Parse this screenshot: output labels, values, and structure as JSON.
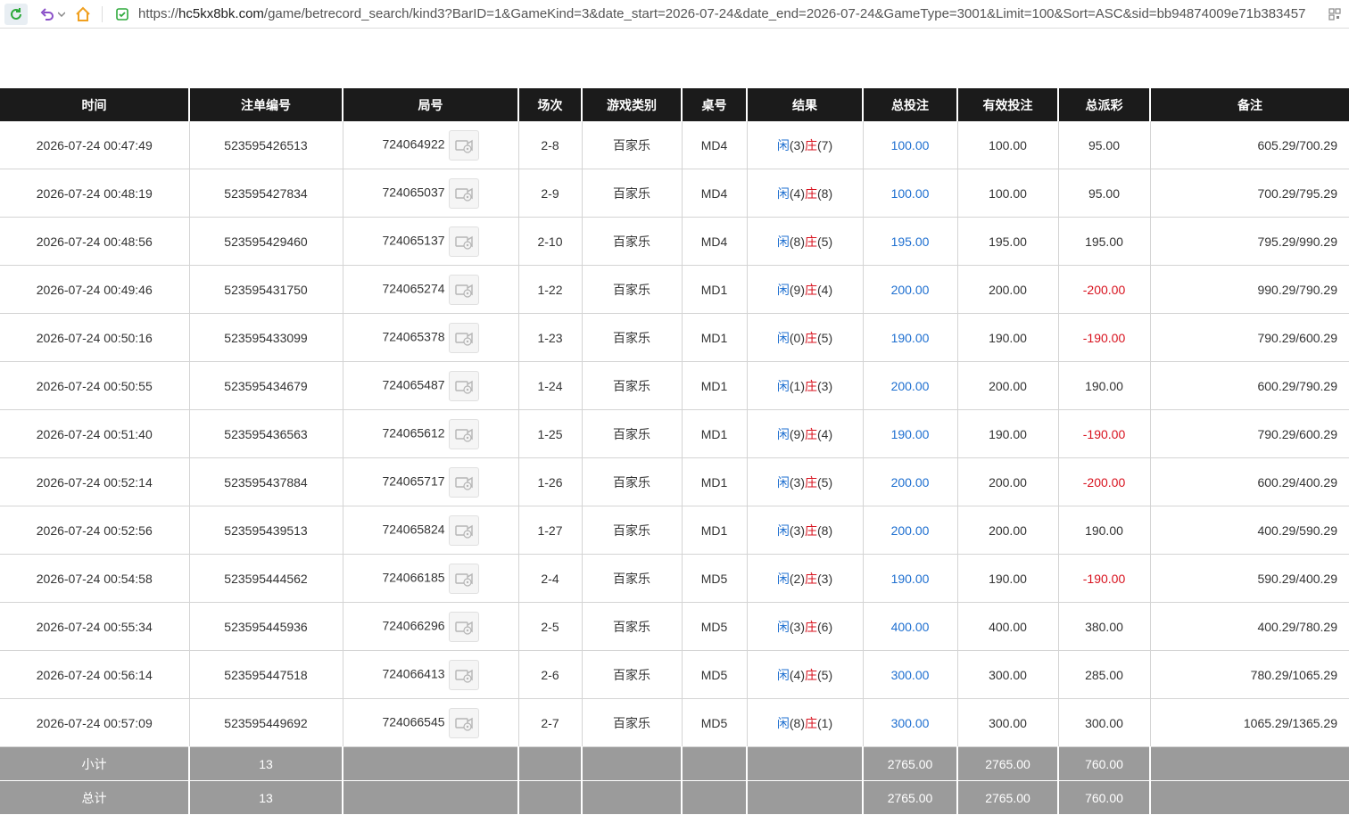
{
  "browser": {
    "url_prefix": "https://",
    "url_host": "hc5kx8bk.com",
    "url_path": "/game/betrecord_search/kind3?BarID=1&GameKind=3&date_start=2026-07-24&date_end=2026-07-24&GameType=3001&Limit=100&Sort=ASC&sid=bb94874009e71b383457",
    "icons": [
      "refresh-icon",
      "undo-icon",
      "chevron-down-icon",
      "home-icon",
      "shield-check-icon",
      "qr-code-icon"
    ]
  },
  "table": {
    "headers": [
      "时间",
      "注单编号",
      "局号",
      "场次",
      "游戏类别",
      "桌号",
      "结果",
      "总投注",
      "有效投注",
      "总派彩",
      "备注"
    ],
    "result_labels": {
      "player": "闲",
      "banker": "庄"
    },
    "rows": [
      {
        "time": "2026-07-24 00:47:49",
        "bet_id": "523595426513",
        "round": "724064922",
        "session": "2-8",
        "game": "百家乐",
        "table": "MD4",
        "p": "(3)",
        "b": "(7)",
        "total": "100.00",
        "valid": "100.00",
        "payout": "95.00",
        "note": "605.29/700.29"
      },
      {
        "time": "2026-07-24 00:48:19",
        "bet_id": "523595427834",
        "round": "724065037",
        "session": "2-9",
        "game": "百家乐",
        "table": "MD4",
        "p": "(4)",
        "b": "(8)",
        "total": "100.00",
        "valid": "100.00",
        "payout": "95.00",
        "note": "700.29/795.29"
      },
      {
        "time": "2026-07-24 00:48:56",
        "bet_id": "523595429460",
        "round": "724065137",
        "session": "2-10",
        "game": "百家乐",
        "table": "MD4",
        "p": "(8)",
        "b": "(5)",
        "total": "195.00",
        "valid": "195.00",
        "payout": "195.00",
        "note": "795.29/990.29"
      },
      {
        "time": "2026-07-24 00:49:46",
        "bet_id": "523595431750",
        "round": "724065274",
        "session": "1-22",
        "game": "百家乐",
        "table": "MD1",
        "p": "(9)",
        "b": "(4)",
        "total": "200.00",
        "valid": "200.00",
        "payout": "-200.00",
        "note": "990.29/790.29"
      },
      {
        "time": "2026-07-24 00:50:16",
        "bet_id": "523595433099",
        "round": "724065378",
        "session": "1-23",
        "game": "百家乐",
        "table": "MD1",
        "p": "(0)",
        "b": "(5)",
        "total": "190.00",
        "valid": "190.00",
        "payout": "-190.00",
        "note": "790.29/600.29"
      },
      {
        "time": "2026-07-24 00:50:55",
        "bet_id": "523595434679",
        "round": "724065487",
        "session": "1-24",
        "game": "百家乐",
        "table": "MD1",
        "p": "(1)",
        "b": "(3)",
        "total": "200.00",
        "valid": "200.00",
        "payout": "190.00",
        "note": "600.29/790.29"
      },
      {
        "time": "2026-07-24 00:51:40",
        "bet_id": "523595436563",
        "round": "724065612",
        "session": "1-25",
        "game": "百家乐",
        "table": "MD1",
        "p": "(9)",
        "b": "(4)",
        "total": "190.00",
        "valid": "190.00",
        "payout": "-190.00",
        "note": "790.29/600.29"
      },
      {
        "time": "2026-07-24 00:52:14",
        "bet_id": "523595437884",
        "round": "724065717",
        "session": "1-26",
        "game": "百家乐",
        "table": "MD1",
        "p": "(3)",
        "b": "(5)",
        "total": "200.00",
        "valid": "200.00",
        "payout": "-200.00",
        "note": "600.29/400.29"
      },
      {
        "time": "2026-07-24 00:52:56",
        "bet_id": "523595439513",
        "round": "724065824",
        "session": "1-27",
        "game": "百家乐",
        "table": "MD1",
        "p": "(3)",
        "b": "(8)",
        "total": "200.00",
        "valid": "200.00",
        "payout": "190.00",
        "note": "400.29/590.29"
      },
      {
        "time": "2026-07-24 00:54:58",
        "bet_id": "523595444562",
        "round": "724066185",
        "session": "2-4",
        "game": "百家乐",
        "table": "MD5",
        "p": "(2)",
        "b": "(3)",
        "total": "190.00",
        "valid": "190.00",
        "payout": "-190.00",
        "note": "590.29/400.29"
      },
      {
        "time": "2026-07-24 00:55:34",
        "bet_id": "523595445936",
        "round": "724066296",
        "session": "2-5",
        "game": "百家乐",
        "table": "MD5",
        "p": "(3)",
        "b": "(6)",
        "total": "400.00",
        "valid": "400.00",
        "payout": "380.00",
        "note": "400.29/780.29"
      },
      {
        "time": "2026-07-24 00:56:14",
        "bet_id": "523595447518",
        "round": "724066413",
        "session": "2-6",
        "game": "百家乐",
        "table": "MD5",
        "p": "(4)",
        "b": "(5)",
        "total": "300.00",
        "valid": "300.00",
        "payout": "285.00",
        "note": "780.29/1065.29"
      },
      {
        "time": "2026-07-24 00:57:09",
        "bet_id": "523595449692",
        "round": "724066545",
        "session": "2-7",
        "game": "百家乐",
        "table": "MD5",
        "p": "(8)",
        "b": "(1)",
        "total": "300.00",
        "valid": "300.00",
        "payout": "300.00",
        "note": "1065.29/1365.29"
      }
    ],
    "subtotal": {
      "label": "小计",
      "count": "13",
      "total": "2765.00",
      "valid": "2765.00",
      "payout": "760.00"
    },
    "grand_total": {
      "label": "总计",
      "count": "13",
      "total": "2765.00",
      "valid": "2765.00",
      "payout": "760.00"
    }
  },
  "colors": {
    "header_bg": "#1b1b1b",
    "sum_bg": "#9b9b9b",
    "blue": "#1e6fd0",
    "red": "#d8121e",
    "accent_green": "#2eaa3c",
    "home_orange": "#f0a020"
  }
}
